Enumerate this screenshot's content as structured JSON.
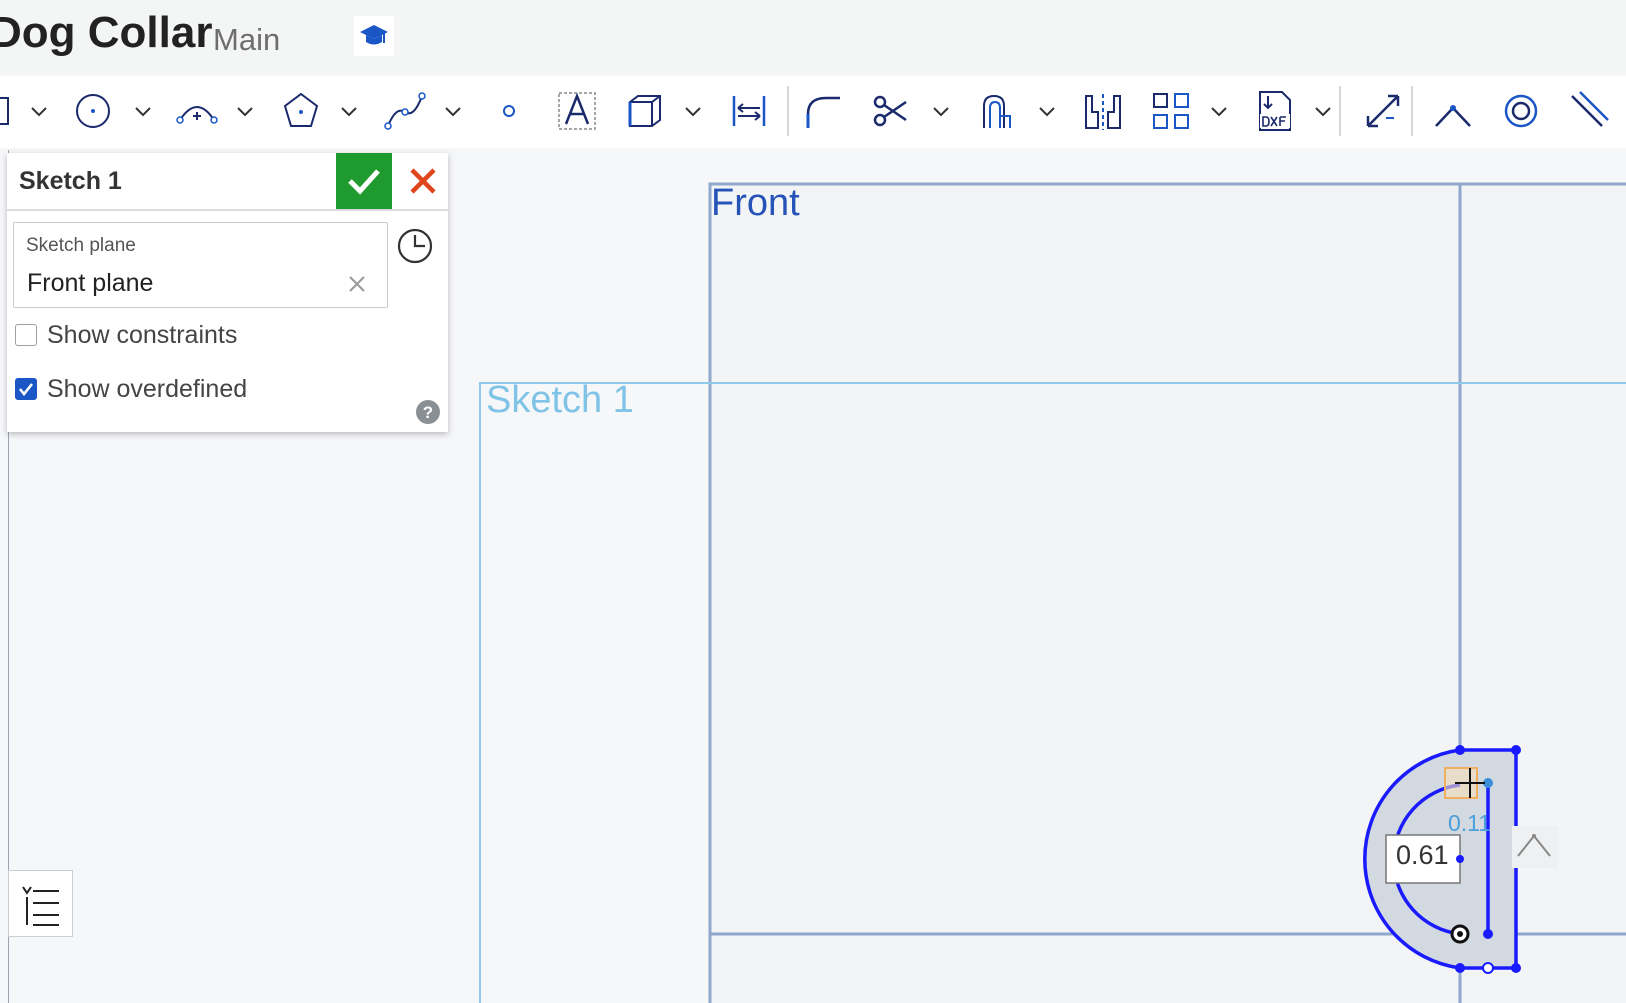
{
  "header": {
    "title": "Dog Collar",
    "branch": "Main",
    "learning_icon": "graduation-cap-icon"
  },
  "toolbar": {
    "tools": [
      {
        "name": "line-tool",
        "icon": "line-icon"
      },
      {
        "name": "circle-tool",
        "icon": "circle-icon"
      },
      {
        "name": "arc-tool",
        "icon": "arc-icon"
      },
      {
        "name": "polygon-tool",
        "icon": "polygon-icon"
      },
      {
        "name": "spline-tool",
        "icon": "spline-icon"
      },
      {
        "name": "point-tool",
        "icon": "point-icon"
      },
      {
        "name": "text-tool",
        "icon": "text-icon"
      },
      {
        "name": "use-tool",
        "icon": "use-icon"
      },
      {
        "name": "dimension-tool",
        "icon": "dimension-icon"
      },
      {
        "name": "fillet-tool",
        "icon": "fillet-icon"
      },
      {
        "name": "trim-tool",
        "icon": "scissors-icon"
      },
      {
        "name": "offset-tool",
        "icon": "offset-icon"
      },
      {
        "name": "mirror-tool",
        "icon": "mirror-icon"
      },
      {
        "name": "pattern-tool",
        "icon": "grid-pattern-icon"
      },
      {
        "name": "dxf-import-tool",
        "icon": "dxf-icon"
      },
      {
        "name": "transform-tool",
        "icon": "transform-icon"
      },
      {
        "name": "coincident-constraint",
        "icon": "coincident-icon"
      },
      {
        "name": "concentric-constraint",
        "icon": "concentric-icon"
      },
      {
        "name": "parallel-constraint",
        "icon": "parallel-icon"
      }
    ]
  },
  "sketch_panel": {
    "title": "Sketch 1",
    "confirm_icon": "checkmark-icon",
    "cancel_icon": "close-icon",
    "plane_label": "Sketch plane",
    "plane_value": "Front plane",
    "show_constraints_label": "Show constraints",
    "show_constraints_checked": false,
    "show_overdefined_label": "Show overdefined",
    "show_overdefined_checked": true
  },
  "viewport": {
    "front_plane_label": "Front",
    "sketch_plane_label": "Sketch 1",
    "dimension_value": "0.61",
    "dimension_value_2": "0.11"
  },
  "colors": {
    "accent_blue": "#1a56c6",
    "confirm_green": "#1f9a2e",
    "cancel_red": "#e0461d",
    "plane_blue": "#2553b8",
    "sketch_blue": "#7fc3e6"
  }
}
